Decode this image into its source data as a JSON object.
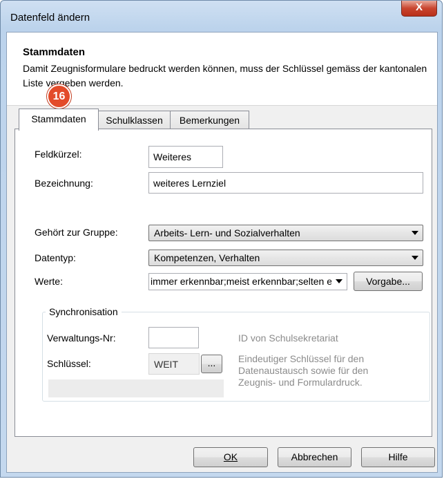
{
  "window": {
    "title": "Datenfeld ändern",
    "close_label": "X"
  },
  "header": {
    "title": "Stammdaten",
    "description": "Damit Zeugnisformulare bedruckt werden können, muss der Schlüssel gemäss der kantonalen Liste vergeben werden."
  },
  "marker": "16",
  "tabs": [
    {
      "label": "Stammdaten",
      "active": true
    },
    {
      "label": "Schulklassen",
      "active": false
    },
    {
      "label": "Bemerkungen",
      "active": false
    }
  ],
  "form": {
    "feldkuerzel": {
      "label": "Feldkürzel:",
      "value": "Weiteres"
    },
    "bezeichnung": {
      "label": "Bezeichnung:",
      "value": "weiteres Lernziel"
    },
    "gruppe": {
      "label": "Gehört zur Gruppe:",
      "value": "Arbeits- Lern- und Sozialverhalten"
    },
    "datentyp": {
      "label": "Datentyp:",
      "value": "Kompetenzen, Verhalten"
    },
    "werte": {
      "label": "Werte:",
      "value": "immer erkennbar;meist erkennbar;selten erkennbar",
      "button": "Vorgabe..."
    }
  },
  "sync": {
    "title": "Synchronisation",
    "verwaltung": {
      "label": "Verwaltungs-Nr:",
      "value": "",
      "hint": "ID von Schulsekretariat"
    },
    "schluessel": {
      "label": "Schlüssel:",
      "value": "WEIT",
      "browse": "...",
      "hint": "Eindeutiger Schlüssel für den Datenaustausch sowie für den Zeugnis- und Formulardruck."
    }
  },
  "buttons": {
    "ok": "OK",
    "cancel": "Abbrechen",
    "help": "Hilfe"
  }
}
